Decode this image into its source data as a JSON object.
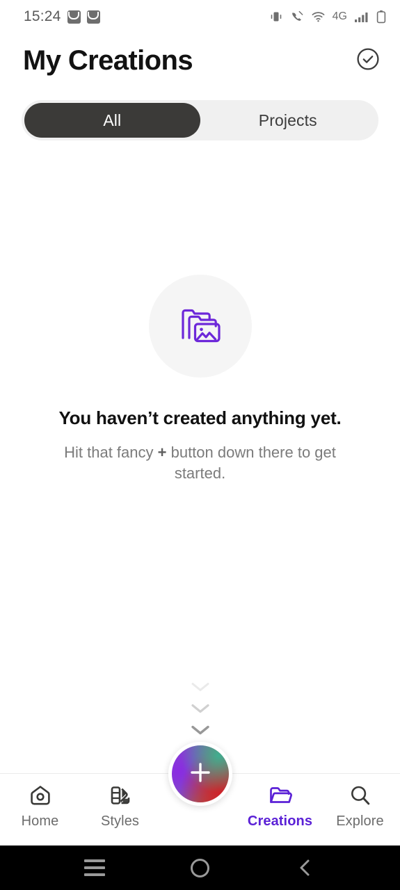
{
  "status_bar": {
    "time": "15:24",
    "notification_icons": [
      "mail-icon",
      "mail-icon"
    ],
    "right_icons": [
      "vibrate-icon",
      "call-mute-icon",
      "wifi-icon",
      "signal-bars-icon",
      "battery-icon"
    ],
    "network_label": "4G"
  },
  "header": {
    "title": "My Creations",
    "action_icon": "check-circle-icon"
  },
  "tabs": {
    "items": [
      {
        "label": "All",
        "active": true
      },
      {
        "label": "Projects",
        "active": false
      }
    ],
    "active_bg": "#3b3a38",
    "track_bg": "#f0f0f0"
  },
  "empty_state": {
    "icon": "folder-image-stack-icon",
    "icon_color": "#6d28d9",
    "icon_circle_bg": "#f5f5f5",
    "title": "You haven’t created anything yet.",
    "subtitle_before": "Hit that fancy ",
    "subtitle_plus": "+",
    "subtitle_after": " button down there to get started."
  },
  "hint_chevrons": {
    "icon": "chevron-down-icon",
    "count": 4
  },
  "bottom_nav": {
    "active_color": "#5b21d6",
    "inactive_color": "#6c6c6c",
    "items": [
      {
        "label": "Home",
        "icon": "home-camera-icon",
        "active": false
      },
      {
        "label": "Styles",
        "icon": "color-palette-icon",
        "active": false
      },
      {
        "label": "Creations",
        "icon": "folder-open-icon",
        "active": true
      },
      {
        "label": "Explore",
        "icon": "search-icon",
        "active": false
      }
    ],
    "fab": {
      "icon": "plus-icon",
      "gradient_colors": [
        "#8b3fd4",
        "#3fae90",
        "#cf2f31"
      ]
    }
  },
  "android_nav": {
    "buttons": [
      "recents-menu-icon",
      "home-circle-icon",
      "back-chevron-icon"
    ]
  }
}
